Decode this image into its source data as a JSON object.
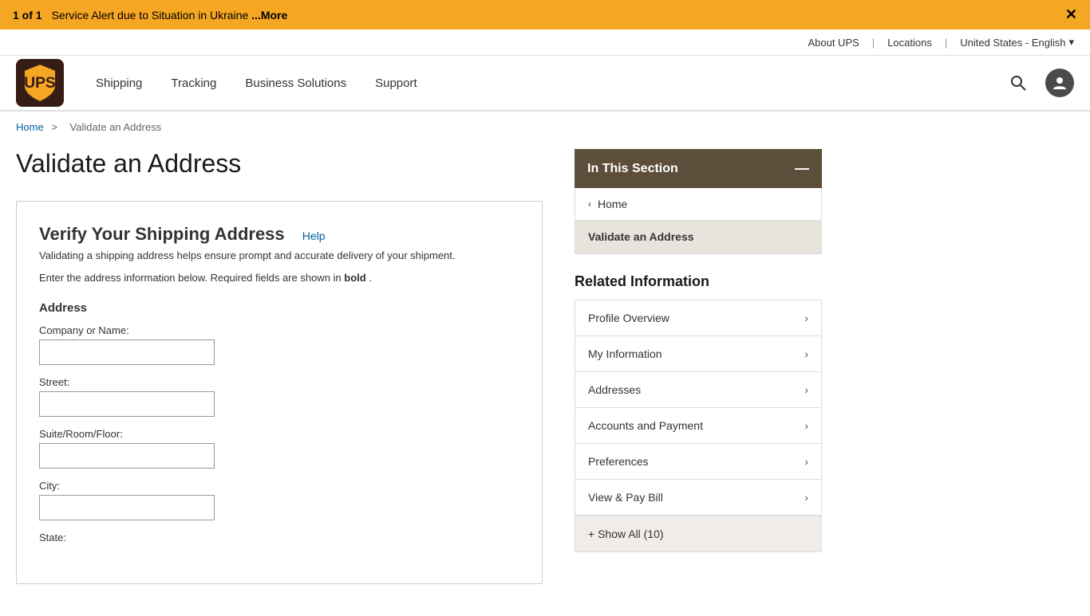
{
  "alert": {
    "count": "1 of 1",
    "message": "Service Alert due to Situation in Ukraine",
    "link_text": "...More"
  },
  "top_nav": {
    "about": "About UPS",
    "locations": "Locations",
    "language": "United States - English"
  },
  "main_nav": {
    "shipping": "Shipping",
    "tracking": "Tracking",
    "business": "Business Solutions",
    "support": "Support"
  },
  "breadcrumb": {
    "home": "Home",
    "separator": ">",
    "current": "Validate an Address"
  },
  "page": {
    "title": "Validate an Address"
  },
  "form": {
    "title": "Verify Your Shipping Address",
    "help_link": "Help",
    "desc1": "Validating a shipping address helps ensure prompt and accurate delivery of your shipment.",
    "desc2_part1": "Enter the address information below. Required fields are shown in",
    "desc2_bold": "bold",
    "desc2_part2": ".",
    "address_label": "Address",
    "company_label": "Company or Name:",
    "street_label": "Street:",
    "suite_label": "Suite/Room/Floor:",
    "city_label": "City:",
    "state_label": "State:"
  },
  "sidebar": {
    "section_title": "In This Section",
    "collapse_icon": "—",
    "nav_items": [
      {
        "label": "Home",
        "type": "back",
        "active": false
      },
      {
        "label": "Validate an Address",
        "type": "current",
        "active": true
      }
    ],
    "related_title": "Related Information",
    "related_links": [
      {
        "label": "Profile Overview"
      },
      {
        "label": "My Information"
      },
      {
        "label": "Addresses"
      },
      {
        "label": "Accounts and Payment"
      },
      {
        "label": "Preferences"
      },
      {
        "label": "View & Pay Bill"
      }
    ],
    "show_all": "+ Show All (10)"
  }
}
